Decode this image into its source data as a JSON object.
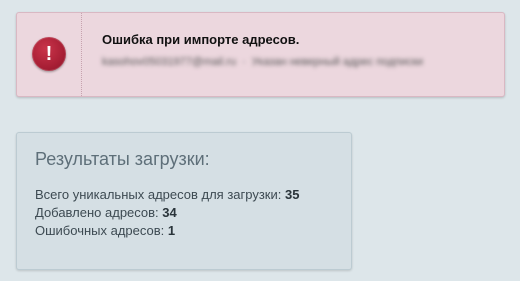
{
  "error": {
    "icon_glyph": "!",
    "icon_name": "error-icon",
    "title": "Ошибка при импорте адресов.",
    "detail_email": "kasohov05031977@mail.ru",
    "detail_message": "Указан неверный адрес подписки",
    "color": "#a81f35"
  },
  "results": {
    "title": "Результаты загрузки:",
    "total_label": "Всего уникальных адресов для загрузки: ",
    "total_value": "35",
    "added_label": "Добавлено адресов: ",
    "added_value": "34",
    "errors_label": "Ошибочных адресов: ",
    "errors_value": "1"
  }
}
